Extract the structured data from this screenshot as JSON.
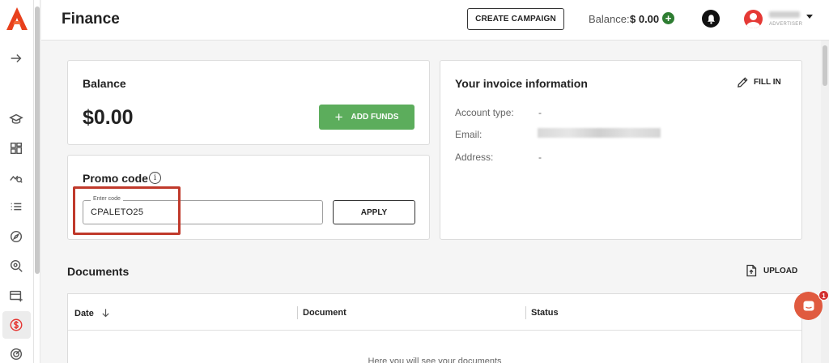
{
  "header": {
    "title": "Finance",
    "create_campaign_label": "CREATE CAMPAIGN",
    "balance_label": "Balance:",
    "balance_amount": "$ 0.00",
    "add_balance_symbol": "+",
    "user_role": "ADVERTISER"
  },
  "sidebar": {
    "logo": "app-logo",
    "items": [
      {
        "icon": "arrow-right-icon"
      },
      {
        "icon": "graduation-cap-icon"
      },
      {
        "icon": "dashboard-icon"
      },
      {
        "icon": "analytics-search-icon"
      },
      {
        "icon": "list-icon"
      },
      {
        "icon": "compass-icon"
      },
      {
        "icon": "radar-search-icon"
      },
      {
        "icon": "card-add-icon"
      },
      {
        "icon": "dollar-circle-icon",
        "active": true
      },
      {
        "icon": "target-icon"
      }
    ]
  },
  "balance_card": {
    "title": "Balance",
    "value": "$0.00",
    "add_funds_symbol": "+",
    "add_funds_label": "ADD FUNDS"
  },
  "promo_card": {
    "title": "Promo code",
    "info_symbol": "i",
    "field_label": "Enter code",
    "field_value": "CPALETO25",
    "apply_label": "APPLY"
  },
  "invoice_card": {
    "title": "Your invoice information",
    "fill_in_label": "FILL IN",
    "rows": [
      {
        "label": "Account type:",
        "value": "-"
      },
      {
        "label": "Email:",
        "value": ""
      },
      {
        "label": "Address:",
        "value": "-"
      }
    ]
  },
  "documents": {
    "title": "Documents",
    "upload_label": "UPLOAD",
    "columns": [
      "Date",
      "Document",
      "Status"
    ],
    "empty_text": "Here you will see your documents"
  },
  "chat": {
    "badge_count": "1"
  },
  "colors": {
    "accent_green": "#5cad5c",
    "highlight_red": "#c0392b",
    "brand_red": "#e53935"
  }
}
